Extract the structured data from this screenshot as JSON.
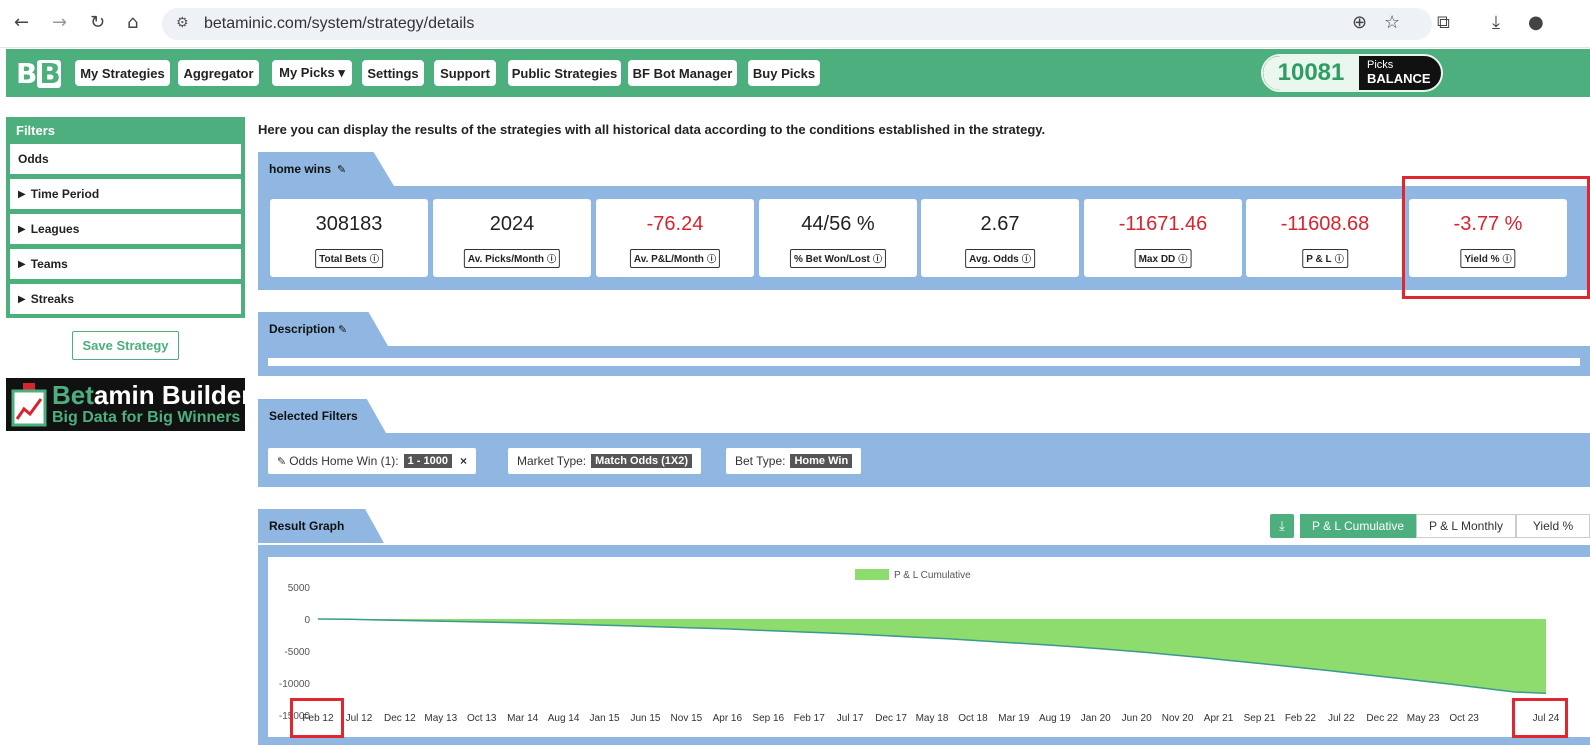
{
  "browser": {
    "url": "betaminic.com/system/strategy/details"
  },
  "nav": {
    "logo": "BB",
    "buttons": [
      "My Strategies",
      "Aggregator",
      "My Picks ▾",
      "Settings",
      "Support",
      "Public Strategies",
      "BF Bot Manager",
      "Buy Picks"
    ],
    "balance": {
      "value": "10081",
      "line1": "Picks",
      "line2": "BALANCE"
    }
  },
  "sidebar": {
    "title": "Filters",
    "items": [
      "Odds",
      "Time Period",
      "Leagues",
      "Teams",
      "Streaks"
    ],
    "save": "Save Strategy",
    "banner": {
      "title_a": "Bet",
      "title_b": "amin Builder",
      "subtitle": "Big Data for Big Winners"
    }
  },
  "main": {
    "intro": "Here you can display the results of the strategies with all historical data according to the conditions established in the strategy.",
    "strategy_name": "home wins",
    "stats": [
      {
        "value": "308183",
        "label": "Total Bets",
        "negative": false
      },
      {
        "value": "2024",
        "label": "Av. Picks/Month",
        "negative": false
      },
      {
        "value": "-76.24",
        "label": "Av. P&L/Month",
        "negative": true
      },
      {
        "value": "44/56 %",
        "label": "% Bet Won/Lost",
        "negative": false
      },
      {
        "value": "2.67",
        "label": "Avg. Odds",
        "negative": false
      },
      {
        "value": "-11671.46",
        "label": "Max DD",
        "negative": true
      },
      {
        "value": "-11608.68",
        "label": "P & L",
        "negative": true
      },
      {
        "value": "-3.77 %",
        "label": "Yield %",
        "negative": true
      }
    ],
    "description_tab": "Description",
    "filters_tab": "Selected Filters",
    "chips": [
      {
        "label": "Odds Home Win (1):",
        "value": "1 - 1000",
        "closable": true
      },
      {
        "label": "Market Type:",
        "value": "Match Odds (1X2)",
        "closable": false
      },
      {
        "label": "Bet Type:",
        "value": "Home Win",
        "closable": false
      }
    ],
    "graph_tab": "Result Graph",
    "graph_buttons": [
      "P & L Cumulative",
      "P & L Monthly",
      "Yield %"
    ],
    "graph_active": "P & L Cumulative"
  },
  "colors": {
    "green": "#4caf7d",
    "blue": "#8fb7e2",
    "red": "#d9232e",
    "area": "#8fdc6e"
  },
  "chart_data": {
    "type": "area",
    "legend": "P & L Cumulative",
    "y_ticks": [
      5000,
      0,
      -5000,
      -10000,
      -15000
    ],
    "ylim": [
      -15000,
      5000
    ],
    "x_ticks": [
      "Feb 12",
      "Jul 12",
      "Dec 12",
      "May 13",
      "Oct 13",
      "Mar 14",
      "Aug 14",
      "Jan 15",
      "Jun 15",
      "Nov 15",
      "Apr 16",
      "Sep 16",
      "Feb 17",
      "Jul 17",
      "Dec 17",
      "May 18",
      "Oct 18",
      "Mar 19",
      "Aug 19",
      "Jan 20",
      "Jun 20",
      "Nov 20",
      "Apr 21",
      "Sep 21",
      "Feb 22",
      "Jul 22",
      "Dec 22",
      "May 23",
      "Oct 23",
      "",
      "Jul 24"
    ],
    "series": [
      {
        "name": "P & L Cumulative",
        "values": [
          0,
          -50,
          -150,
          -250,
          -350,
          -450,
          -550,
          -650,
          -800,
          -950,
          -1100,
          -1250,
          -1400,
          -1550,
          -1750,
          -1950,
          -2150,
          -2350,
          -2600,
          -2850,
          -3100,
          -3400,
          -3700,
          -4000,
          -4350,
          -4700,
          -5100,
          -5550,
          -6000,
          -6500,
          -7000,
          -7500,
          -8000,
          -8550,
          -9100,
          -9650,
          -10200,
          -10800,
          -11400,
          -11608.68
        ]
      }
    ]
  }
}
